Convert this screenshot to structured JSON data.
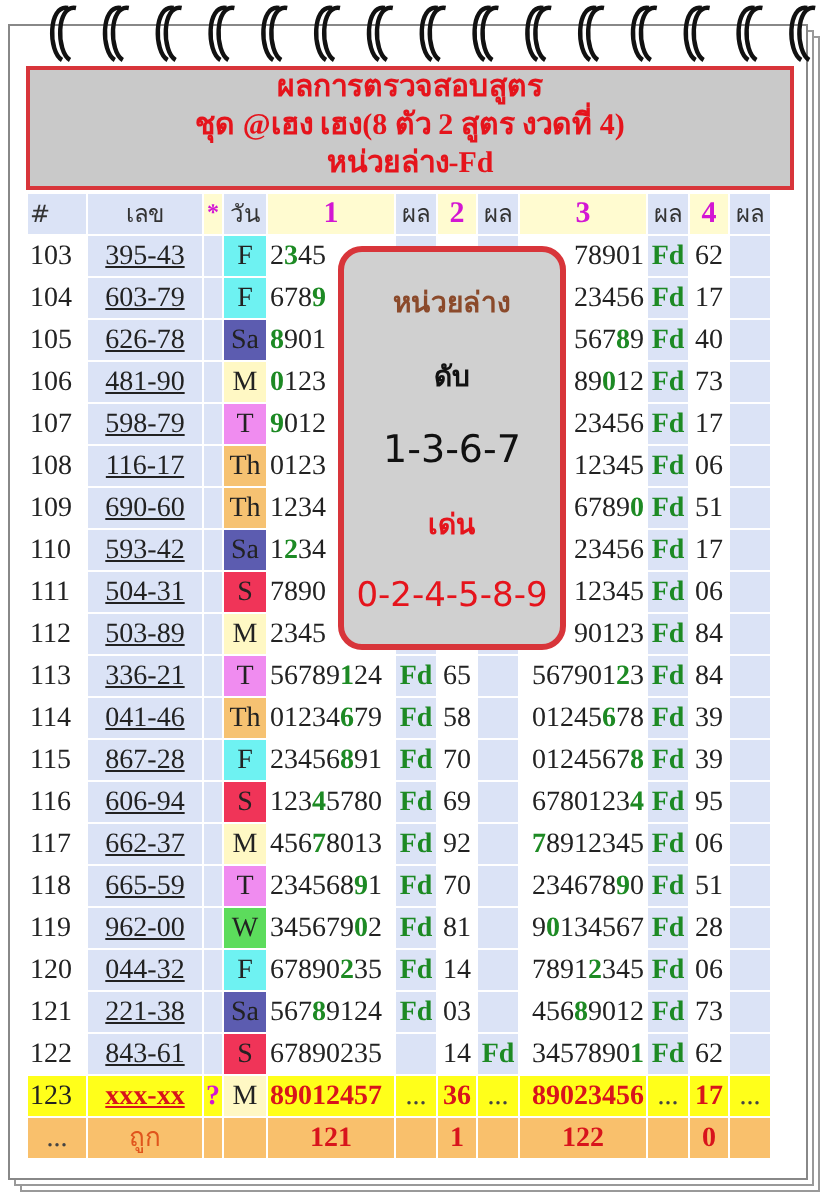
{
  "title_lines": [
    "ผลการตรวจสอบสูตร",
    "ชุด @เฮง เฮง(8 ตัว 2 สูตร งวดที่ 4)",
    "หน่วยล่าง-Fd"
  ],
  "header": [
    "#",
    "เลข",
    "*",
    "วัน",
    "1",
    "ผล",
    "2",
    "ผล",
    "3",
    "ผล",
    "4",
    "ผล"
  ],
  "rows": [
    {
      "kind": "history",
      "num": "103",
      "code": "395-43",
      "day": "F",
      "color": "#6ef2f2",
      "n1": "2**3**45",
      "n3": "78901",
      "r3": "Fd",
      "n4": "62"
    },
    {
      "kind": "history",
      "num": "104",
      "code": "603-79",
      "day": "F",
      "color": "#6ef2f2",
      "n1": "678**9**",
      "n3": "23456",
      "r3": "Fd",
      "n4": "17"
    },
    {
      "kind": "history",
      "num": "105",
      "code": "626-78",
      "day": "Sa",
      "color": "#5c5cb0",
      "n1": "**8**901",
      "n3": "567**8**9",
      "r3": "Fd",
      "n4": "40"
    },
    {
      "kind": "history",
      "num": "106",
      "code": "481-90",
      "day": "M",
      "color": "#fff8c4",
      "n1": "**0**123",
      "n3": "89**0**12",
      "r3": "Fd",
      "n4": "73"
    },
    {
      "kind": "history",
      "num": "107",
      "code": "598-79",
      "day": "T",
      "color": "#f08cf0",
      "n1": "**9**012",
      "n3": "23456",
      "r3": "Fd",
      "n4": "17"
    },
    {
      "kind": "history",
      "num": "108",
      "code": "116-17",
      "day": "Th",
      "color": "#f6c272",
      "n1": "0123",
      "n3": "12345",
      "r3": "Fd",
      "n4": "06"
    },
    {
      "kind": "history",
      "num": "109",
      "code": "690-60",
      "day": "Th",
      "color": "#f6c272",
      "n1": "1234",
      "n3": "6789**0**",
      "r3": "Fd",
      "n4": "51"
    },
    {
      "kind": "history",
      "num": "110",
      "code": "593-42",
      "day": "Sa",
      "color": "#5c5cb0",
      "n1": "1**2**34",
      "n3": "23456",
      "r3": "Fd",
      "n4": "17"
    },
    {
      "kind": "history",
      "num": "111",
      "code": "504-31",
      "day": "S",
      "color": "#f03458",
      "n1": "7890",
      "n3": "12345",
      "r3": "Fd",
      "n4": "06"
    },
    {
      "kind": "history",
      "num": "112",
      "code": "503-89",
      "day": "M",
      "color": "#fff8c4",
      "n1": "2345",
      "n3": "90123",
      "r3": "Fd",
      "n4": "84"
    },
    {
      "kind": "history",
      "num": "113",
      "code": "336-21",
      "day": "T",
      "color": "#f08cf0",
      "n1": "56789**1**24",
      "r1": "Fd",
      "n2": "65",
      "n3": "567901**2**3",
      "r3": "Fd",
      "n4": "84"
    },
    {
      "kind": "history",
      "num": "114",
      "code": "041-46",
      "day": "Th",
      "color": "#f6c272",
      "n1": "01234**6**79",
      "r1": "Fd",
      "n2": "58",
      "n3": "01245**6**78",
      "r3": "Fd",
      "n4": "39"
    },
    {
      "kind": "history",
      "num": "115",
      "code": "867-28",
      "day": "F",
      "color": "#6ef2f2",
      "n1": "23456**8**91",
      "r1": "Fd",
      "n2": "70",
      "n3": "0124567**8**",
      "r3": "Fd",
      "n4": "39"
    },
    {
      "kind": "history",
      "num": "116",
      "code": "606-94",
      "day": "S",
      "color": "#f03458",
      "n1": "123**4**5780",
      "r1": "Fd",
      "n2": "69",
      "n3": "6780123**4**",
      "r3": "Fd",
      "n4": "95"
    },
    {
      "kind": "history",
      "num": "117",
      "code": "662-37",
      "day": "M",
      "color": "#fff8c4",
      "n1": "456**7**8013",
      "r1": "Fd",
      "n2": "92",
      "n3": "**7**8912345",
      "r3": "Fd",
      "n4": "06"
    },
    {
      "kind": "history",
      "num": "118",
      "code": "665-59",
      "day": "T",
      "color": "#f08cf0",
      "n1": "234568**9**1",
      "r1": "Fd",
      "n2": "70",
      "n3": "234678**9**0",
      "r3": "Fd",
      "n4": "51"
    },
    {
      "kind": "history",
      "num": "119",
      "code": "962-00",
      "day": "W",
      "color": "#5cdc5c",
      "n1": "345679**0**2",
      "r1": "Fd",
      "n2": "81",
      "n3": "9**0**134567",
      "r3": "Fd",
      "n4": "28"
    },
    {
      "kind": "history",
      "num": "120",
      "code": "044-32",
      "day": "F",
      "color": "#6ef2f2",
      "n1": "67890**2**35",
      "r1": "Fd",
      "n2": "14",
      "n3": "7891**2**345",
      "r3": "Fd",
      "n4": "06"
    },
    {
      "kind": "history",
      "num": "121",
      "code": "221-38",
      "day": "Sa",
      "color": "#5c5cb0",
      "n1": "567**8**9124",
      "r1": "Fd",
      "n2": "03",
      "n3": "456**8**9012",
      "r3": "Fd",
      "n4": "73"
    },
    {
      "kind": "history",
      "num": "122",
      "code": "843-61",
      "day": "S",
      "color": "#f03458",
      "n1": "67890235",
      "n2": "14",
      "r2": "Fd",
      "n3": "3457890**1**",
      "r3": "Fd",
      "n4": "62"
    },
    {
      "kind": "current",
      "num": "123",
      "code": "xxx-xx",
      "mark": "?",
      "day": "M",
      "color": "#fff8c4",
      "n1": "89012457",
      "r1": "...",
      "n2": "36",
      "r2": "...",
      "n3": "89023456",
      "r3": "...",
      "n4": "17",
      "r4": "..."
    }
  ],
  "footer": {
    "num": "...",
    "code": "ถูก",
    "n1": "121",
    "n2": "1",
    "n3": "122",
    "n4": "0"
  },
  "popup": {
    "title": "หน่วยล่าง",
    "label_1": "ดับ",
    "value_1": "1-3-6-7",
    "label_2": "เด่น",
    "value_2": "0-2-4-5-8-9"
  }
}
